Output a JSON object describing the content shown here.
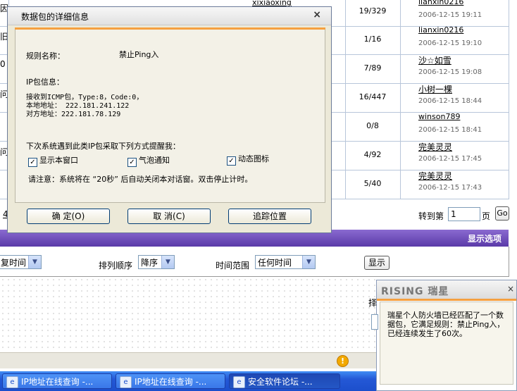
{
  "forum": {
    "rows": [
      {
        "left": "因",
        "subject": "xixiaoxing",
        "replies": "19/329",
        "author": "lianxin0216",
        "time": "2006-12-15 19:11"
      },
      {
        "left": "旧",
        "subject": "",
        "replies": "1/16",
        "author": "lianxin0216",
        "time": "2006-12-15 19:10"
      },
      {
        "left": "0",
        "subject": "",
        "replies": "7/89",
        "author": "沙☆如雪",
        "time": "2006-12-15 19:08"
      },
      {
        "left": "问",
        "subject": "",
        "replies": "16/447",
        "author": "小树一棵",
        "time": "2006-12-15 18:44"
      },
      {
        "left": "",
        "subject": "",
        "replies": "0/8",
        "author": "winson789",
        "time": "2006-12-15 18:41"
      },
      {
        "left": "问",
        "subject": "",
        "replies": "4/92",
        "author": "完美灵灵",
        "time": "2006-12-15 17:45"
      },
      {
        "left": "",
        "subject": "",
        "replies": "5/40",
        "author": "完美灵灵",
        "time": "2006-12-15 17:43"
      }
    ],
    "pager": {
      "left_digit": "4",
      "goto_label": "转到第",
      "page_value": "1",
      "page_unit": "页",
      "go_button": "Go"
    }
  },
  "display_options": {
    "title": "显示选项"
  },
  "filter": {
    "time_select": "复时间",
    "order_label": "排列顺序",
    "order_select": "降序",
    "range_label": "时间范围",
    "range_select": "任何时间",
    "show_button": "显示"
  },
  "dialog": {
    "title": "数据包的详细信息",
    "rule_label": "规则名称：",
    "rule_value": "禁止Ping入",
    "ip_info_label": "IP包信息：",
    "ip_line1": "接收到ICMP包，Type:8，Code:0，",
    "ip_line2": "本地地址： 222.181.241.122",
    "ip_line3": "对方地址：222.181.78.129",
    "next_label": "下次系统遇到此类IP包采取下列方式提醒我：",
    "options": [
      "显示本窗口",
      "气泡通知",
      "动态图标"
    ],
    "note": "请注意：系统将在 “20秒” 后自动关闭本对话窗。双击停止计时。",
    "buttons": [
      "确 定(O)",
      "取 消(C)",
      "追踪位置"
    ]
  },
  "popup": {
    "brand": "RISING 瑞星",
    "message": "瑞星个人防火墙已经匹配了一个数据包，它满足规则：禁止Ping入，已经连续发生了60次。",
    "side_chars": [
      "择"
    ]
  },
  "taskbar": {
    "buttons": [
      "IP地址在线查询 -...",
      "IP地址在线查询 -...",
      "安全软件论坛 -..."
    ],
    "active_index": 2
  },
  "colors": {
    "accent_orange": "#f5a040",
    "purple_bar": "#6a4ab8",
    "taskbar_blue": "#2458d6"
  }
}
